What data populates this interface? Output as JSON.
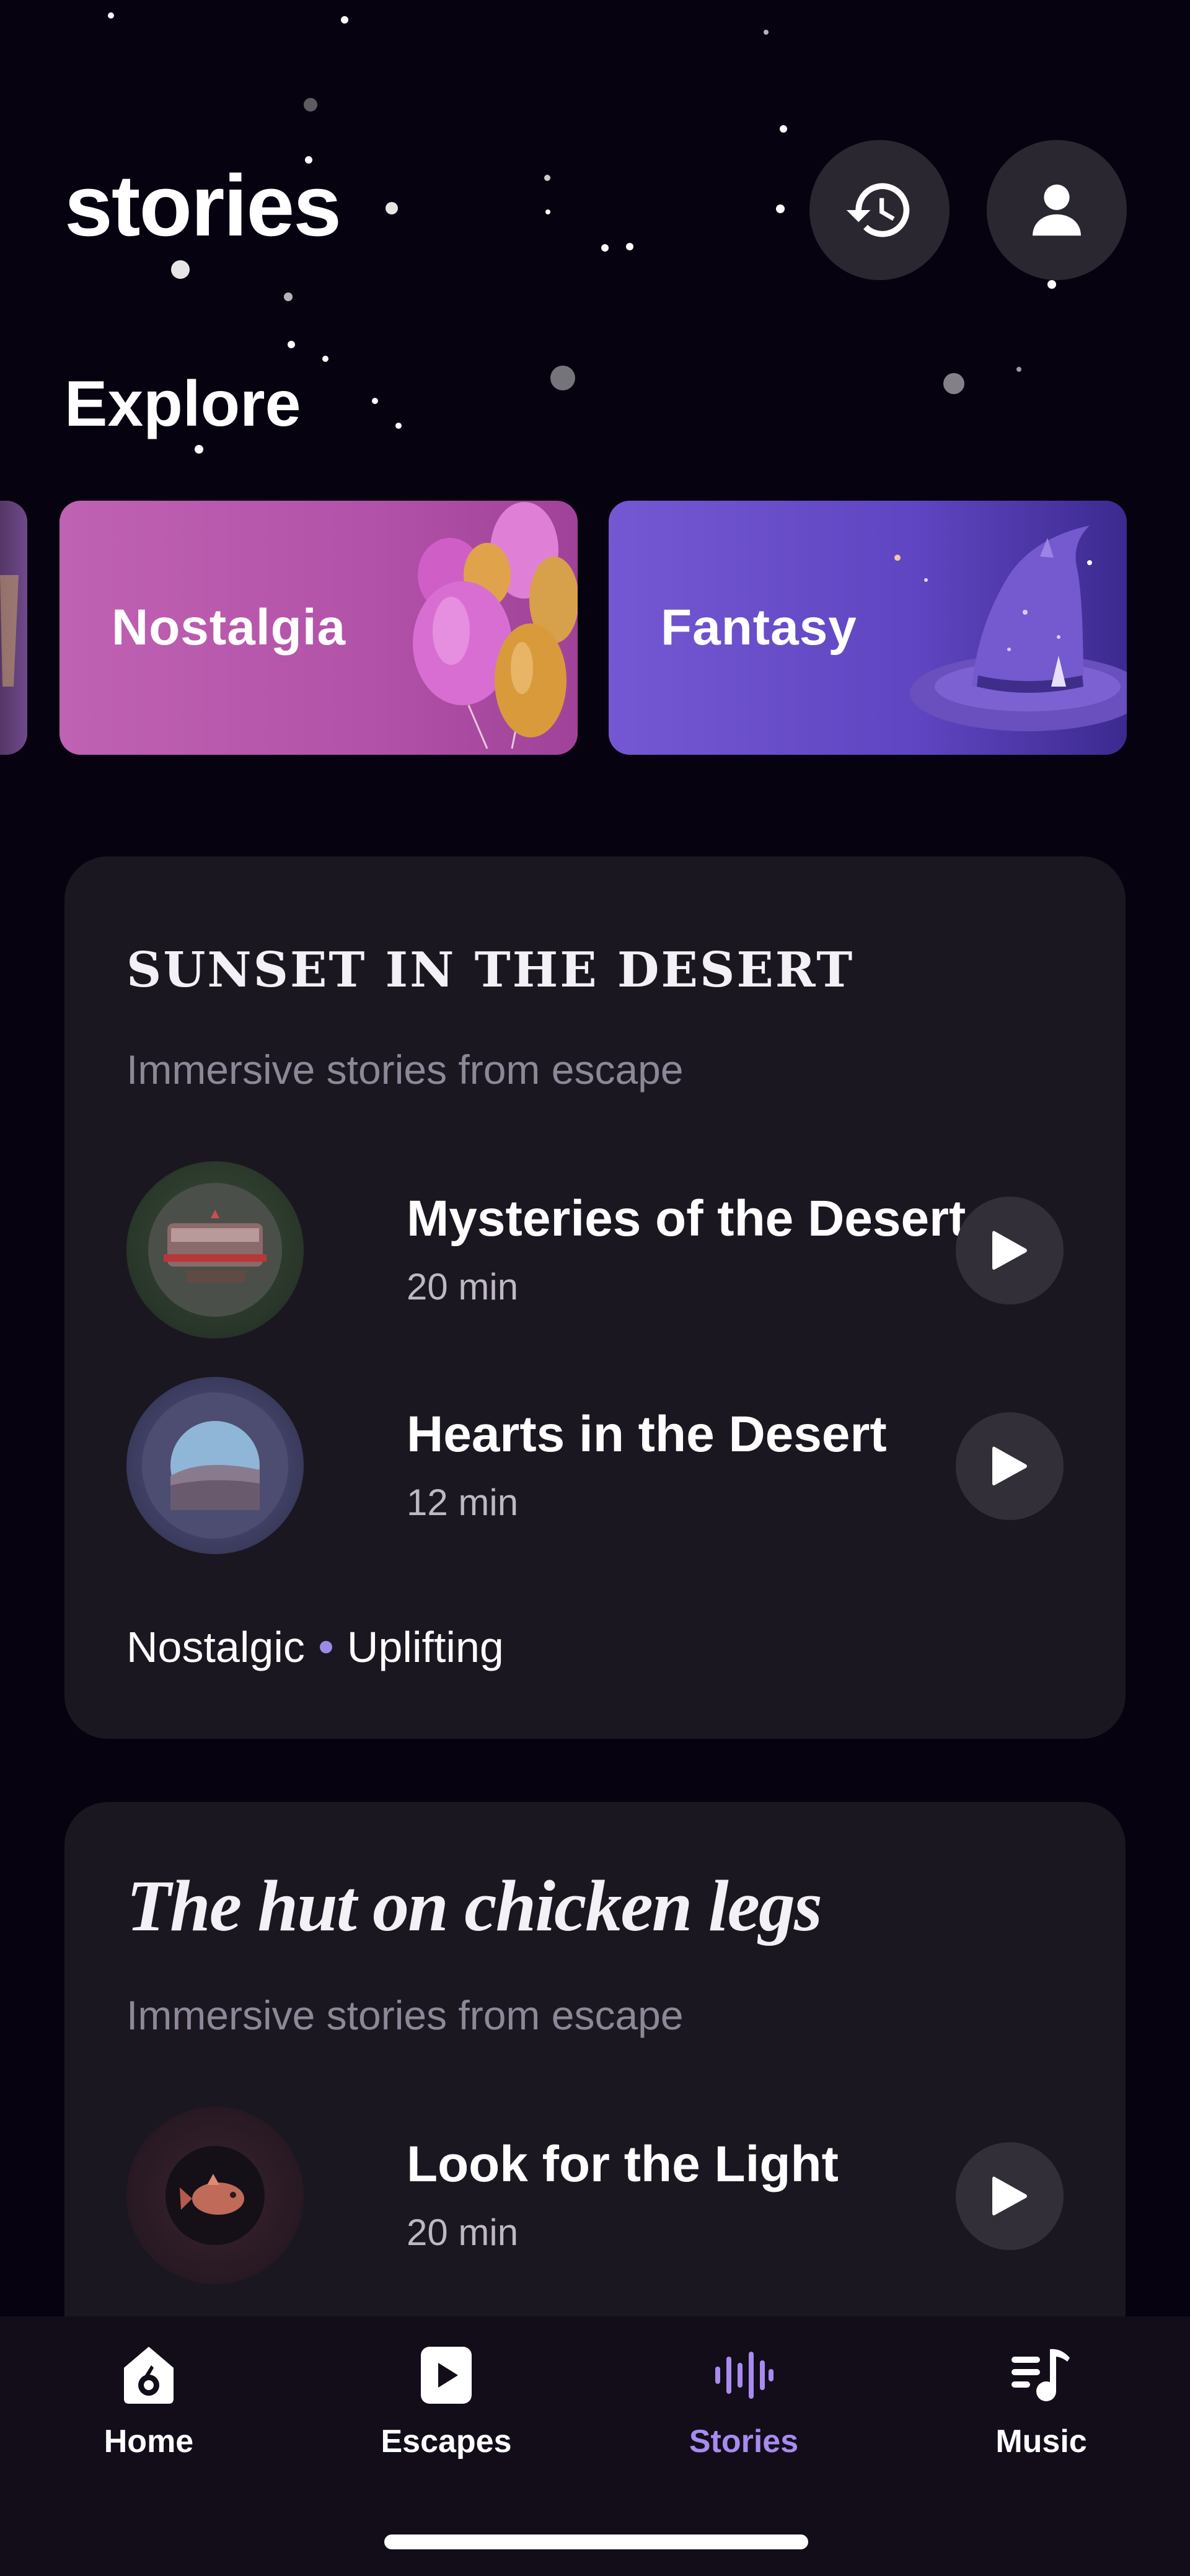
{
  "header": {
    "title": "stories",
    "history_icon": "history-icon",
    "profile_icon": "person-icon"
  },
  "explore": {
    "heading": "Explore",
    "categories": [
      {
        "label": "Nostalgia",
        "icon": "balloons-illustration",
        "color": "#c563b8"
      },
      {
        "label": "Fantasy",
        "icon": "wizard-hat-illustration",
        "color": "#6d53cf"
      }
    ]
  },
  "cards": [
    {
      "title": "SUNSET IN THE DESERT",
      "subtitle": "Immersive stories from escape",
      "stories": [
        {
          "title": "Mysteries of the Desert",
          "duration": "20 min",
          "thumb": "brookes-sign-thumbnail"
        },
        {
          "title": "Hearts in the Desert",
          "duration": "12 min",
          "thumb": "desert-landscape-thumbnail"
        }
      ],
      "tags": [
        "Nostalgic",
        "Uplifting"
      ]
    },
    {
      "title": "The hut on chicken legs",
      "subtitle": "Immersive stories from escape",
      "stories": [
        {
          "title": "Look for the Light",
          "duration": "20 min",
          "thumb": "glowing-fish-thumbnail"
        }
      ]
    }
  ],
  "nav": {
    "items": [
      {
        "label": "Home",
        "icon": "home-icon"
      },
      {
        "label": "Escapes",
        "icon": "play-square-icon"
      },
      {
        "label": "Stories",
        "icon": "soundwave-icon",
        "active": true
      },
      {
        "label": "Music",
        "icon": "music-list-icon"
      }
    ],
    "active_color": "#a78bef"
  }
}
